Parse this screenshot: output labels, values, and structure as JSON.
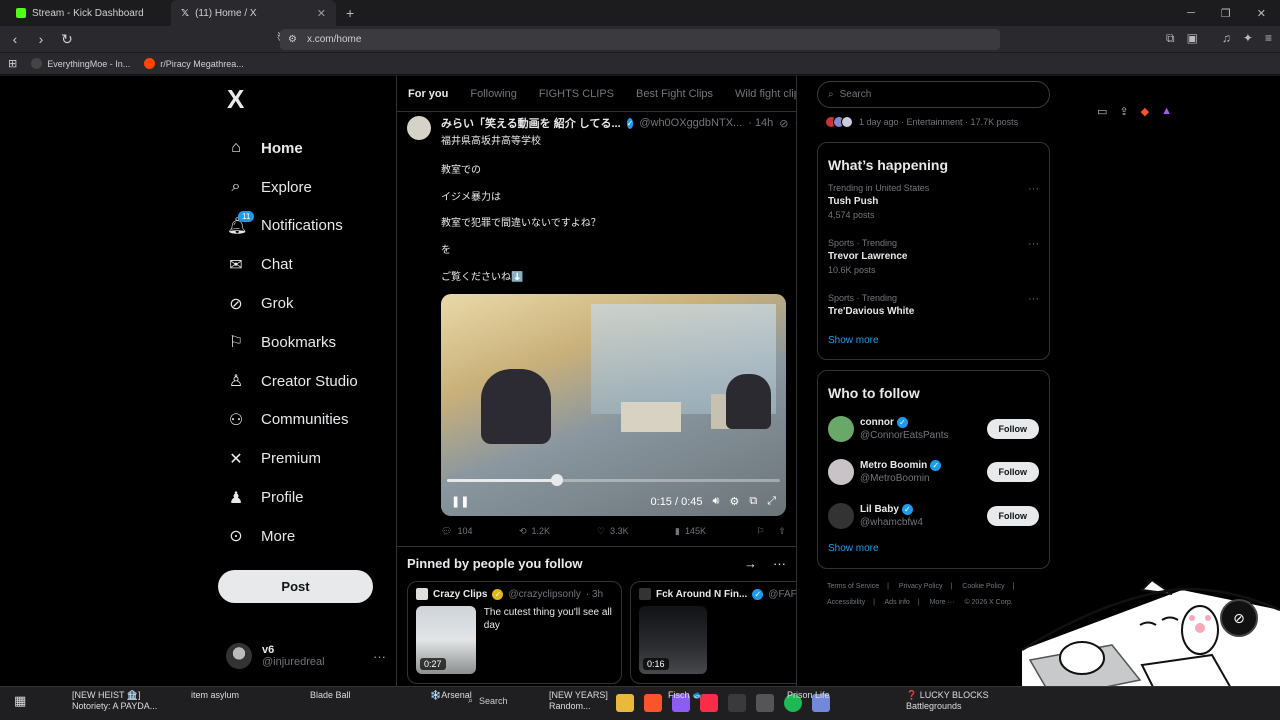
{
  "browser": {
    "tabs": [
      {
        "label": "Stream - Kick Dashboard",
        "icon": "kick-icon"
      },
      {
        "label": "(11) Home / X",
        "icon": "x-icon"
      }
    ],
    "url": "x.com/home",
    "bookmarks": [
      {
        "label": "EverythingMoe - In...",
        "icon": "e-icon"
      },
      {
        "label": "r/Piracy Megathrea...",
        "icon": "reddit-icon"
      }
    ]
  },
  "nav": {
    "logo": "X",
    "items": [
      {
        "label": "Home",
        "icon": "home-icon",
        "active": true
      },
      {
        "label": "Explore",
        "icon": "search-icon"
      },
      {
        "label": "Notifications",
        "icon": "bell-icon",
        "badge": "11"
      },
      {
        "label": "Chat",
        "icon": "mail-icon"
      },
      {
        "label": "Grok",
        "icon": "grok-icon"
      },
      {
        "label": "Bookmarks",
        "icon": "bookmark-icon"
      },
      {
        "label": "Creator Studio",
        "icon": "creator-icon"
      },
      {
        "label": "Communities",
        "icon": "communities-icon"
      },
      {
        "label": "Premium",
        "icon": "x-premium-icon"
      },
      {
        "label": "Profile",
        "icon": "person-icon"
      },
      {
        "label": "More",
        "icon": "more-circle-icon"
      }
    ],
    "post_label": "Post",
    "account": {
      "name": "v6",
      "handle": "@injuredreal"
    }
  },
  "feed": {
    "tabs": [
      "For you",
      "Following",
      "FIGHTS CLIPS",
      "Best Fight Clips",
      "Wild fight clips"
    ],
    "tweet": {
      "name": "みらい「笑える動画を 紹介 してる...",
      "handle": "@wh0OXggdbNTX...",
      "time": "· 14h",
      "subtitle": "福井県高坂井高等学校",
      "lines": [
        "教室での",
        "イジメ暴力は",
        "教室で犯罪で間違いないですよね？",
        "を",
        "ご覧くださいね⬇️"
      ],
      "video": {
        "time": "0:15 / 0:45",
        "progress": 0.33
      },
      "replies": "104",
      "reposts": "1.2K",
      "likes": "3.3K",
      "views": "145K"
    },
    "pinned": {
      "title": "Pinned by people you follow",
      "cards": [
        {
          "name": "Crazy Clips",
          "handle": "@crazyclipsonly",
          "time": "· 3h",
          "text": "The cutest thing you'll see all day",
          "duration": "0:27"
        },
        {
          "name": "Fck Around N Fin...",
          "handle": "@FAF...",
          "time": "",
          "text": "",
          "duration": "0:16"
        }
      ]
    }
  },
  "sidebar": {
    "search_placeholder": "Search",
    "top_meta": "1 day ago · Entertainment · 17.7K posts",
    "whats_happening": {
      "title": "What’s happening",
      "trends": [
        {
          "category": "Trending in United States",
          "name": "Tush Push",
          "count": "4,574 posts"
        },
        {
          "category": "Sports · Trending",
          "name": "Trevor Lawrence",
          "count": "10.6K posts"
        },
        {
          "category": "Sports · Trending",
          "name": "Tre'Davious White",
          "count": ""
        }
      ],
      "show_more": "Show more"
    },
    "who_to_follow": {
      "title": "Who to follow",
      "users": [
        {
          "name": "connor",
          "handle": "@ConnorEatsPants",
          "color": "#6aa86a"
        },
        {
          "name": "Metro Boomin",
          "handle": "@MetroBoomin",
          "color": "#c9c3c7"
        },
        {
          "name": "Lil Baby",
          "handle": "@whamcbfw4",
          "color": "#333333"
        }
      ],
      "follow_label": "Follow",
      "show_more": "Show more"
    },
    "footer": [
      "Terms of Service",
      "|",
      "Privacy Policy",
      "|",
      "Cookie Policy",
      "|",
      "Accessibility",
      "|",
      "Ads info",
      "|",
      "More ···",
      "© 2026 X Corp."
    ]
  },
  "taskbar": {
    "items": [
      {
        "title": "[NEW HEIST 🏦]",
        "sub": "Notoriety: A PAYDA..."
      },
      {
        "title": "item asylum",
        "sub": ""
      },
      {
        "title": "Blade Ball",
        "sub": ""
      },
      {
        "title": "❄️Arsenal",
        "sub": ""
      },
      {
        "title": "[NEW YEARS]",
        "sub": "Random..."
      },
      {
        "title": "Fisch 🐟",
        "sub": ""
      },
      {
        "title": "Prison Life",
        "sub": ""
      },
      {
        "title": "❓ LUCKY BLOCKS",
        "sub": "Battlegrounds"
      }
    ],
    "search_label": "Search"
  },
  "colors": {
    "accent": "#1d9bf0",
    "background": "#000000",
    "border": "#2f3336",
    "muted": "#71767b"
  }
}
